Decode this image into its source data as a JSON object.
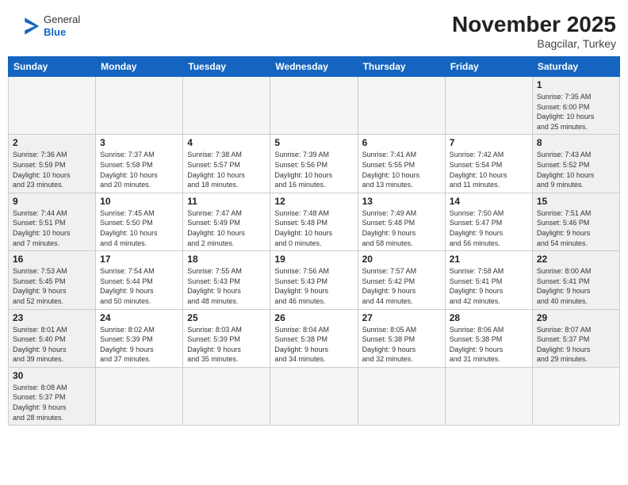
{
  "header": {
    "title": "November 2025",
    "location": "Bagcilar, Turkey",
    "logo_general": "General",
    "logo_blue": "Blue"
  },
  "days_of_week": [
    "Sunday",
    "Monday",
    "Tuesday",
    "Wednesday",
    "Thursday",
    "Friday",
    "Saturday"
  ],
  "weeks": [
    [
      {
        "day": "",
        "info": "",
        "empty": true
      },
      {
        "day": "",
        "info": "",
        "empty": true
      },
      {
        "day": "",
        "info": "",
        "empty": true
      },
      {
        "day": "",
        "info": "",
        "empty": true
      },
      {
        "day": "",
        "info": "",
        "empty": true
      },
      {
        "day": "",
        "info": "",
        "empty": true
      },
      {
        "day": "1",
        "info": "Sunrise: 7:35 AM\nSunset: 6:00 PM\nDaylight: 10 hours\nand 25 minutes.",
        "weekend": true
      }
    ],
    [
      {
        "day": "2",
        "info": "Sunrise: 7:36 AM\nSunset: 5:59 PM\nDaylight: 10 hours\nand 23 minutes.",
        "weekend": true
      },
      {
        "day": "3",
        "info": "Sunrise: 7:37 AM\nSunset: 5:58 PM\nDaylight: 10 hours\nand 20 minutes."
      },
      {
        "day": "4",
        "info": "Sunrise: 7:38 AM\nSunset: 5:57 PM\nDaylight: 10 hours\nand 18 minutes."
      },
      {
        "day": "5",
        "info": "Sunrise: 7:39 AM\nSunset: 5:56 PM\nDaylight: 10 hours\nand 16 minutes."
      },
      {
        "day": "6",
        "info": "Sunrise: 7:41 AM\nSunset: 5:55 PM\nDaylight: 10 hours\nand 13 minutes."
      },
      {
        "day": "7",
        "info": "Sunrise: 7:42 AM\nSunset: 5:54 PM\nDaylight: 10 hours\nand 11 minutes."
      },
      {
        "day": "8",
        "info": "Sunrise: 7:43 AM\nSunset: 5:52 PM\nDaylight: 10 hours\nand 9 minutes.",
        "weekend": true
      }
    ],
    [
      {
        "day": "9",
        "info": "Sunrise: 7:44 AM\nSunset: 5:51 PM\nDaylight: 10 hours\nand 7 minutes.",
        "weekend": true
      },
      {
        "day": "10",
        "info": "Sunrise: 7:45 AM\nSunset: 5:50 PM\nDaylight: 10 hours\nand 4 minutes."
      },
      {
        "day": "11",
        "info": "Sunrise: 7:47 AM\nSunset: 5:49 PM\nDaylight: 10 hours\nand 2 minutes."
      },
      {
        "day": "12",
        "info": "Sunrise: 7:48 AM\nSunset: 5:48 PM\nDaylight: 10 hours\nand 0 minutes."
      },
      {
        "day": "13",
        "info": "Sunrise: 7:49 AM\nSunset: 5:48 PM\nDaylight: 9 hours\nand 58 minutes."
      },
      {
        "day": "14",
        "info": "Sunrise: 7:50 AM\nSunset: 5:47 PM\nDaylight: 9 hours\nand 56 minutes."
      },
      {
        "day": "15",
        "info": "Sunrise: 7:51 AM\nSunset: 5:46 PM\nDaylight: 9 hours\nand 54 minutes.",
        "weekend": true
      }
    ],
    [
      {
        "day": "16",
        "info": "Sunrise: 7:53 AM\nSunset: 5:45 PM\nDaylight: 9 hours\nand 52 minutes.",
        "weekend": true
      },
      {
        "day": "17",
        "info": "Sunrise: 7:54 AM\nSunset: 5:44 PM\nDaylight: 9 hours\nand 50 minutes."
      },
      {
        "day": "18",
        "info": "Sunrise: 7:55 AM\nSunset: 5:43 PM\nDaylight: 9 hours\nand 48 minutes."
      },
      {
        "day": "19",
        "info": "Sunrise: 7:56 AM\nSunset: 5:43 PM\nDaylight: 9 hours\nand 46 minutes."
      },
      {
        "day": "20",
        "info": "Sunrise: 7:57 AM\nSunset: 5:42 PM\nDaylight: 9 hours\nand 44 minutes."
      },
      {
        "day": "21",
        "info": "Sunrise: 7:58 AM\nSunset: 5:41 PM\nDaylight: 9 hours\nand 42 minutes."
      },
      {
        "day": "22",
        "info": "Sunrise: 8:00 AM\nSunset: 5:41 PM\nDaylight: 9 hours\nand 40 minutes.",
        "weekend": true
      }
    ],
    [
      {
        "day": "23",
        "info": "Sunrise: 8:01 AM\nSunset: 5:40 PM\nDaylight: 9 hours\nand 39 minutes.",
        "weekend": true
      },
      {
        "day": "24",
        "info": "Sunrise: 8:02 AM\nSunset: 5:39 PM\nDaylight: 9 hours\nand 37 minutes."
      },
      {
        "day": "25",
        "info": "Sunrise: 8:03 AM\nSunset: 5:39 PM\nDaylight: 9 hours\nand 35 minutes."
      },
      {
        "day": "26",
        "info": "Sunrise: 8:04 AM\nSunset: 5:38 PM\nDaylight: 9 hours\nand 34 minutes."
      },
      {
        "day": "27",
        "info": "Sunrise: 8:05 AM\nSunset: 5:38 PM\nDaylight: 9 hours\nand 32 minutes."
      },
      {
        "day": "28",
        "info": "Sunrise: 8:06 AM\nSunset: 5:38 PM\nDaylight: 9 hours\nand 31 minutes."
      },
      {
        "day": "29",
        "info": "Sunrise: 8:07 AM\nSunset: 5:37 PM\nDaylight: 9 hours\nand 29 minutes.",
        "weekend": true
      }
    ],
    [
      {
        "day": "30",
        "info": "Sunrise: 8:08 AM\nSunset: 5:37 PM\nDaylight: 9 hours\nand 28 minutes.",
        "weekend": true
      },
      {
        "day": "",
        "info": "",
        "empty": true
      },
      {
        "day": "",
        "info": "",
        "empty": true
      },
      {
        "day": "",
        "info": "",
        "empty": true
      },
      {
        "day": "",
        "info": "",
        "empty": true
      },
      {
        "day": "",
        "info": "",
        "empty": true
      },
      {
        "day": "",
        "info": "",
        "empty": true
      }
    ]
  ]
}
